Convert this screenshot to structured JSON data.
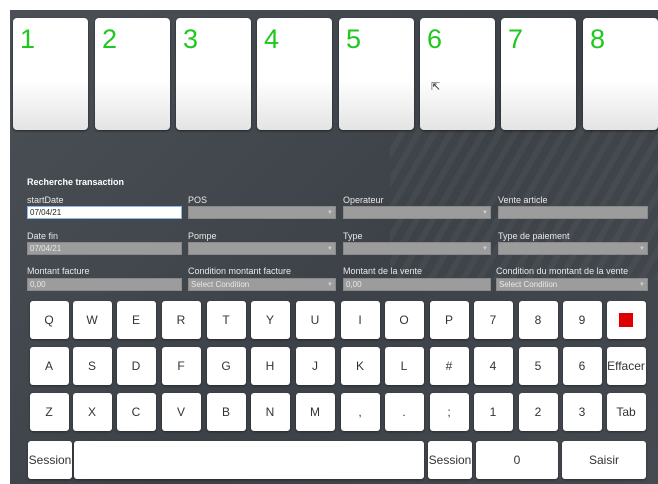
{
  "pumps": [
    "1",
    "2",
    "3",
    "4",
    "5",
    "6",
    "7",
    "8"
  ],
  "form": {
    "title": "Recherche transaction",
    "start_date_label": "startDate",
    "start_date_value": "07/04/21",
    "pos_label": "POS",
    "operateur_label": "Operateur",
    "vente_article_label": "Vente article",
    "date_fin_label": "Date fin",
    "date_fin_value": "07/04/21",
    "pompe_label": "Pompe",
    "type_label": "Type",
    "type_paiement_label": "Type de paiement",
    "montant_facture_label": "Montant facture",
    "montant_facture_value": "0,00",
    "condition_montant_label": "Condition montant facture",
    "condition_montant_value": "Select Condition",
    "montant_vente_label": "Montant de la vente",
    "montant_vente_value": "0,00",
    "condition_vente_label": "Condition du montant de la vente",
    "condition_vente_value": "Select Condition"
  },
  "keyboard": {
    "row1": [
      "Q",
      "W",
      "E",
      "R",
      "T",
      "Y",
      "U",
      "I",
      "O",
      "P",
      "7",
      "8",
      "9"
    ],
    "row2": [
      "A",
      "S",
      "D",
      "F",
      "G",
      "H",
      "J",
      "K",
      "L",
      "#",
      "4",
      "5",
      "6",
      "Effacer"
    ],
    "row3": [
      "Z",
      "X",
      "C",
      "V",
      "B",
      "N",
      "M",
      ",",
      ".",
      ";",
      "1",
      "2",
      "3",
      "Tab"
    ],
    "session_left": "Session",
    "session_right": "Session",
    "zero": "0",
    "saisir": "Saisir"
  },
  "colors": {
    "pump_number": "#1ec81e",
    "stop_key": "#e00000",
    "panel_bg": "#43484e"
  }
}
